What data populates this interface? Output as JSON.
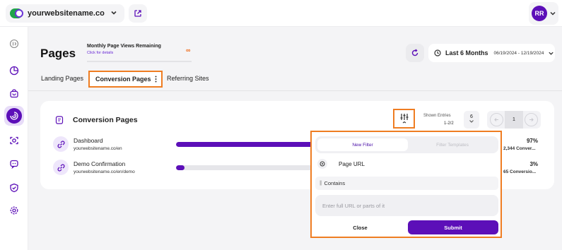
{
  "header": {
    "site_name": "yourwebsitename.co",
    "user_initials": "RR"
  },
  "sidebar": {
    "items": [
      {
        "icon": "collapse-icon"
      },
      {
        "icon": "dashboard-icon"
      },
      {
        "icon": "shopping-bag-icon"
      },
      {
        "icon": "analytics-icon",
        "active": true
      },
      {
        "icon": "scan-icon"
      },
      {
        "icon": "chat-icon"
      },
      {
        "icon": "shield-icon"
      },
      {
        "icon": "settings-icon"
      }
    ]
  },
  "page": {
    "title": "Pages",
    "page_views_title": "Monthly Page Views Remaining",
    "page_views_link": "Click for details",
    "page_views_value": "∞"
  },
  "date": {
    "label": "Last 6 Months",
    "range": "06/19/2024 - 12/19/2024"
  },
  "tabs": [
    {
      "label": "Landing Pages"
    },
    {
      "label": "Conversion Pages",
      "selected": true
    },
    {
      "label": "Referring Sites"
    }
  ],
  "card": {
    "title": "Conversion Pages",
    "shown_entries_label": "Shown Entries",
    "shown_entries_value": "1-2/2",
    "entries_per_page": "6",
    "current_page": "1",
    "rows": [
      {
        "name": "Dashboard",
        "url": "yourwebsitename.co/en",
        "percent": "97%",
        "conversions": "2,344 Conver...",
        "fill": 0.97
      },
      {
        "name": "Demo Confirmation",
        "url": "yourwebsitename.co/en/demo",
        "percent": "3%",
        "conversions": "65 Conversio...",
        "fill": 0.06
      }
    ]
  },
  "filter_popup": {
    "tab_new": "New Filter",
    "tab_templates": "Filter Templates",
    "field_label": "Page URL",
    "operator": "Contains",
    "input_placeholder": "Enter full URL or parts of it",
    "close_label": "Close",
    "submit_label": "Submit"
  },
  "colors": {
    "accent": "#5c0fb8",
    "highlight": "#ef7d22"
  }
}
